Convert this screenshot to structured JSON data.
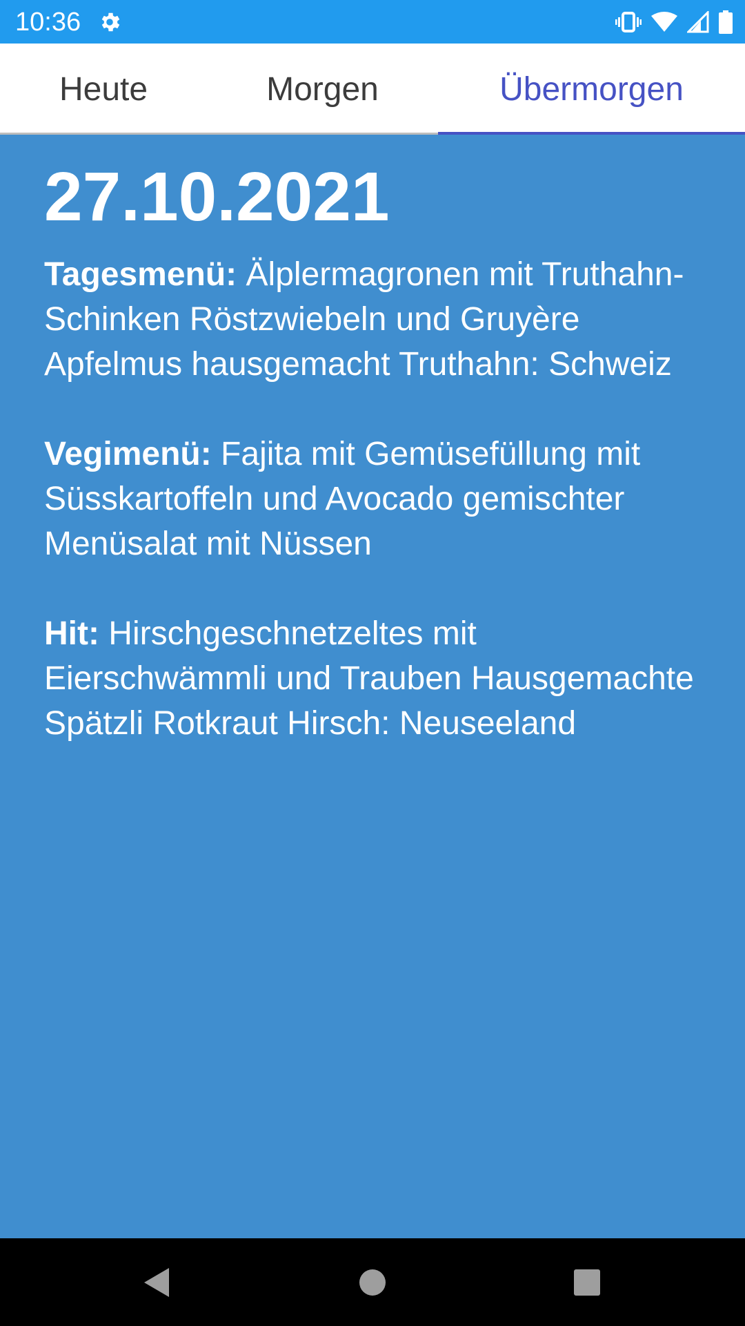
{
  "status_bar": {
    "time": "10:36",
    "icons": [
      "settings-gear-icon",
      "vibrate-icon",
      "wifi-icon",
      "cell-signal-icon",
      "battery-icon"
    ],
    "background": "#219BEE"
  },
  "tabs": [
    {
      "label": "Heute",
      "selected": false
    },
    {
      "label": "Morgen",
      "selected": false
    },
    {
      "label": "Übermorgen",
      "selected": true
    }
  ],
  "accent_color": "#4652C4",
  "content": {
    "background": "#408ECF",
    "date": "27.10.2021",
    "menus": [
      {
        "label": "Tagesmenü:",
        "text": " Älplermagronen mit Truthahn-Schinken Röstzwiebeln und Gruyère Apfelmus hausgemacht Truthahn: Schweiz"
      },
      {
        "label": "Vegimenü:",
        "text": " Fajita mit Gemüsefüllung mit Süsskartoffeln und Avocado gemischter Menüsalat mit Nüssen"
      },
      {
        "label": "Hit:",
        "text": " Hirschgeschnetzeltes mit Eierschwämmli und Trauben Hausgemachte Spätzli Rotkraut Hirsch: Neuseeland"
      }
    ]
  },
  "nav_bar": {
    "buttons": [
      "back-icon",
      "home-icon",
      "recents-icon"
    ]
  }
}
